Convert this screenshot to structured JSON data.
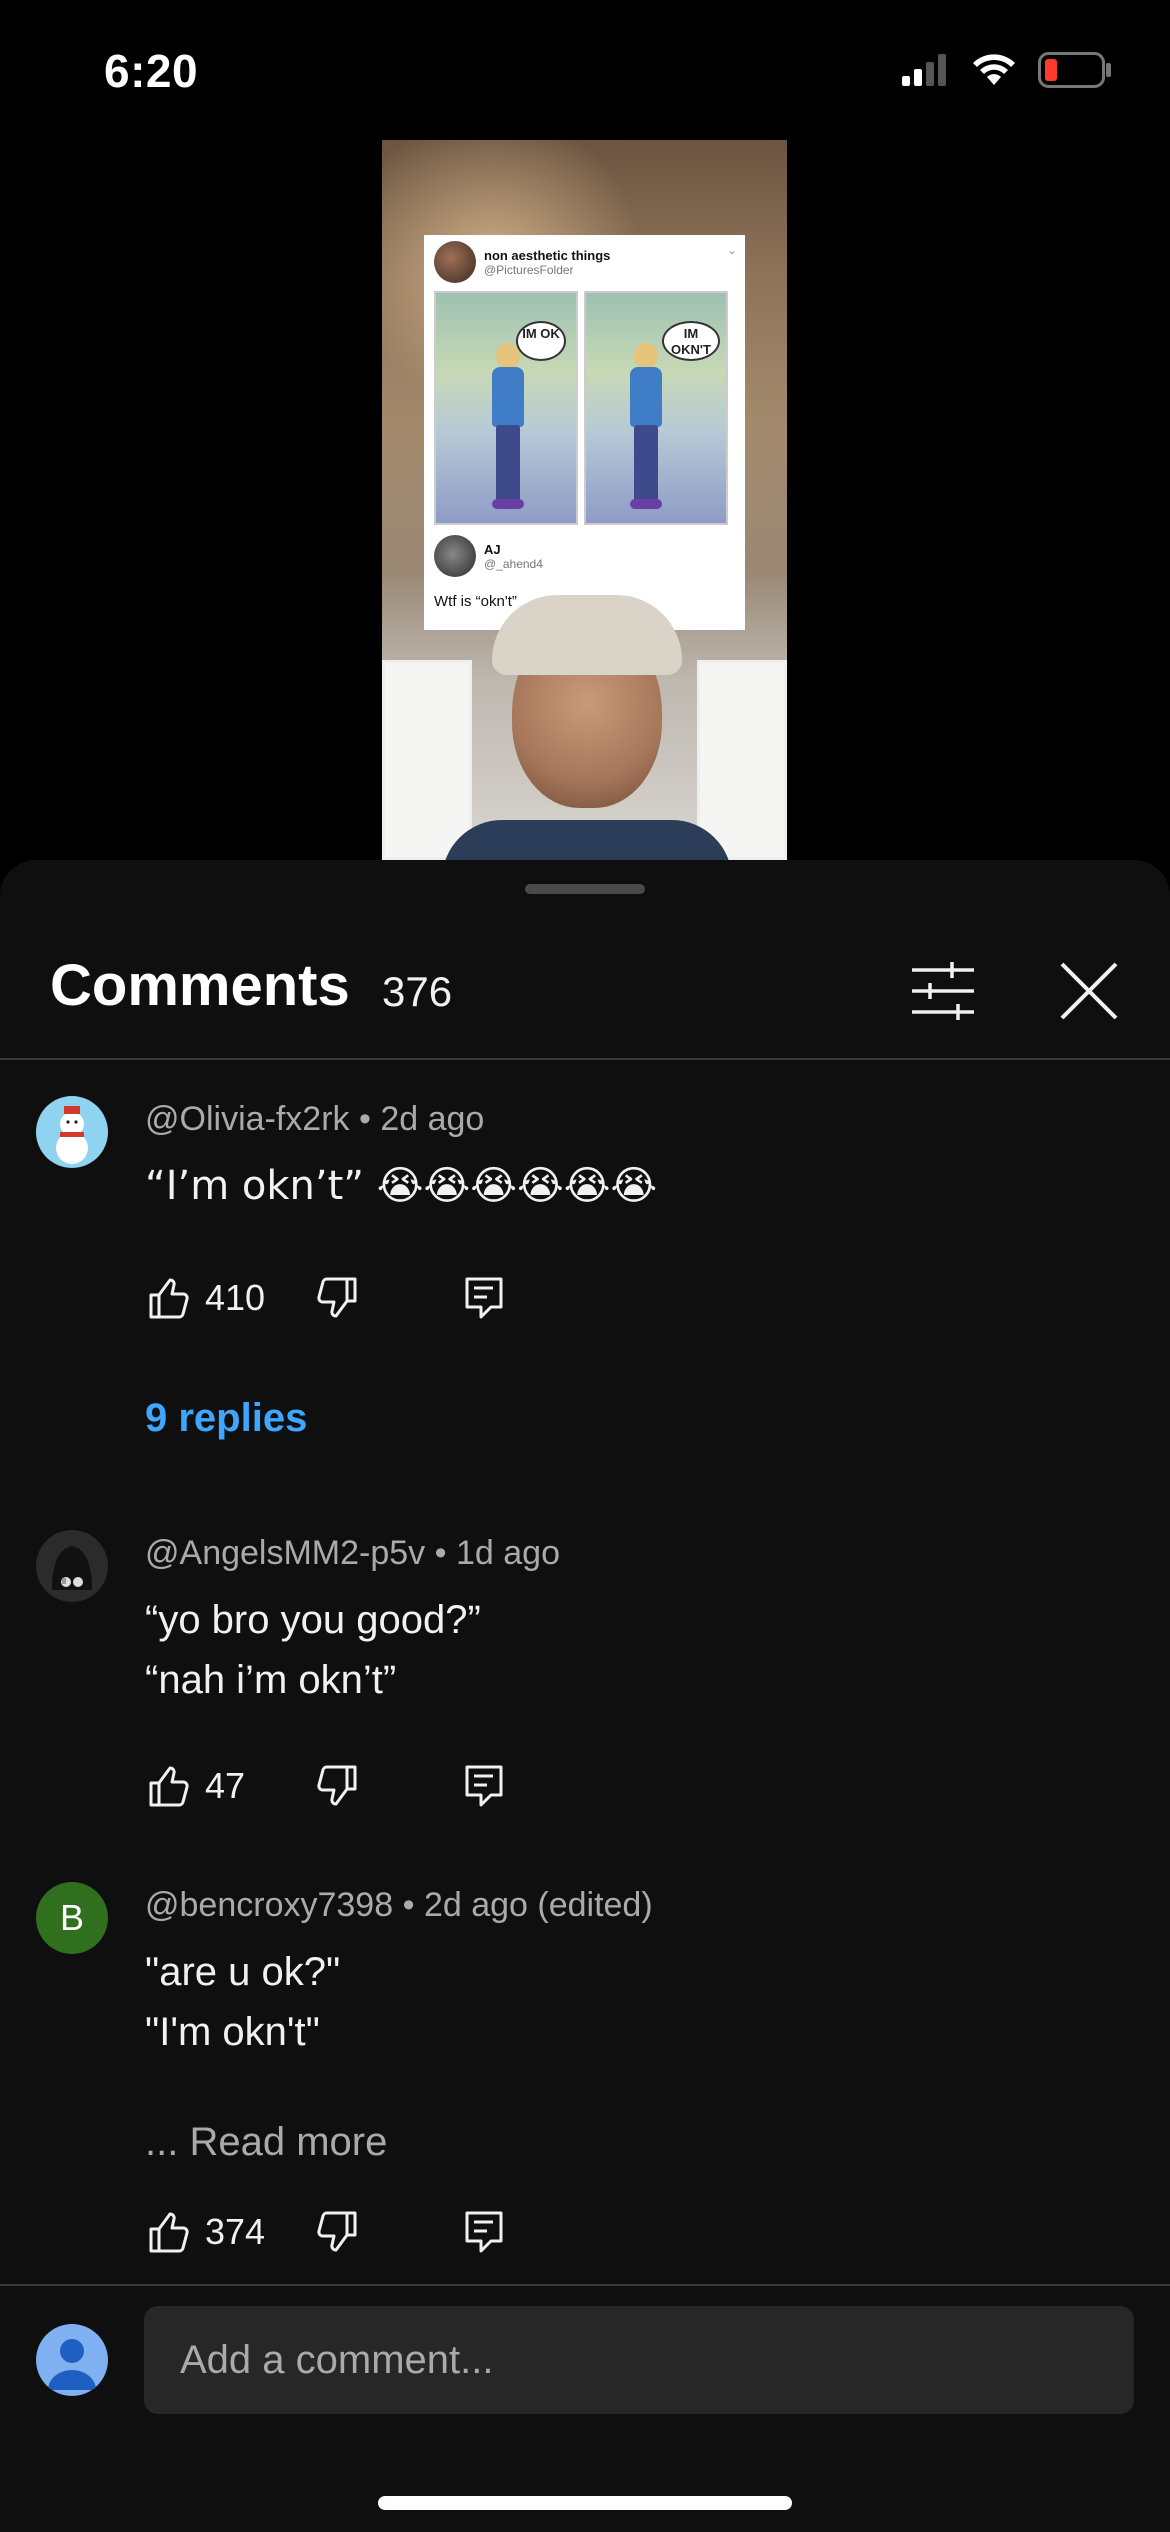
{
  "status_bar": {
    "time": "6:20",
    "icons": [
      "cellular-signal-icon",
      "wifi-icon",
      "battery-low-icon"
    ],
    "battery_color": "#ff3b30"
  },
  "video": {
    "tweet": {
      "author_name": "non aesthetic things",
      "author_handle": "@PicturesFolder",
      "panel_left_bubble": "IM OK",
      "panel_right_bubble": "IM OKN'T",
      "reply_name": "AJ",
      "reply_handle": "@_ahend4",
      "reply_text": "Wtf is “okn't”"
    }
  },
  "comments_panel": {
    "title": "Comments",
    "count": "376",
    "filter_icon": "sliders-icon",
    "close_icon": "close-icon",
    "comments": [
      {
        "author": "@Olivia-fx2rk",
        "time": "2d ago",
        "text": "“I’m okn’t” 😭😭😭😭😭😭",
        "likes": "410",
        "replies_label": "9 replies",
        "avatar_color": "#8fd3f0"
      },
      {
        "author": "@AngelsMM2-p5v",
        "time": "1d ago",
        "text_line1": "“yo bro you good?”",
        "text_line2": "“nah i’m okn’t”",
        "likes": "47",
        "avatar_color": "#2b2b2b"
      },
      {
        "author": "@bencroxy7398",
        "time": "2d ago (edited)",
        "text_line1": "\"are u ok?\"",
        "text_line2": "\"I'm okn't\"",
        "read_more": "... Read more",
        "likes": "374",
        "avatar_letter": "B",
        "avatar_color": "#2f6f1e"
      }
    ]
  },
  "composer": {
    "placeholder": "Add a comment..."
  },
  "colors": {
    "background": "#0f0f0f",
    "link_blue": "#3ea6ff",
    "input_bg": "#272727"
  }
}
